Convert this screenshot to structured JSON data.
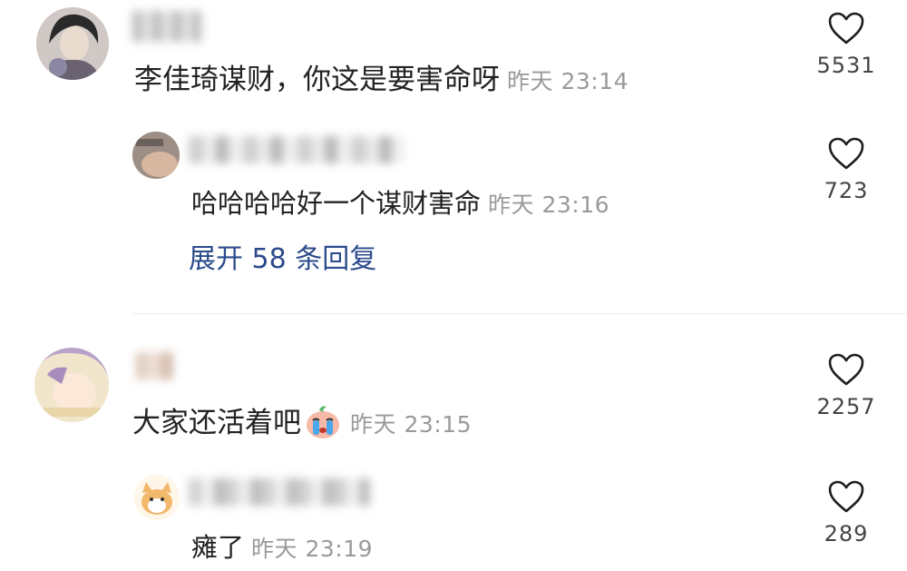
{
  "comments": [
    {
      "text": "李佳琦谋财，你这是要害命呀",
      "time": "昨天 23:14",
      "likes": "5531",
      "replies": [
        {
          "text": "哈哈哈哈好一个谋财害命",
          "time": "昨天 23:16",
          "likes": "723"
        }
      ],
      "expand_label": "展开 58 条回复"
    },
    {
      "text": "大家还活着吧",
      "emoji": "crying-face-emoji",
      "time": "昨天 23:15",
      "likes": "2257",
      "replies": [
        {
          "text": "瘫了",
          "time": "昨天 23:19",
          "likes": "289"
        }
      ]
    }
  ],
  "colors": {
    "accent_link": "#2b4a8c",
    "time_text": "#9a9a9a",
    "divider": "#ececec"
  }
}
